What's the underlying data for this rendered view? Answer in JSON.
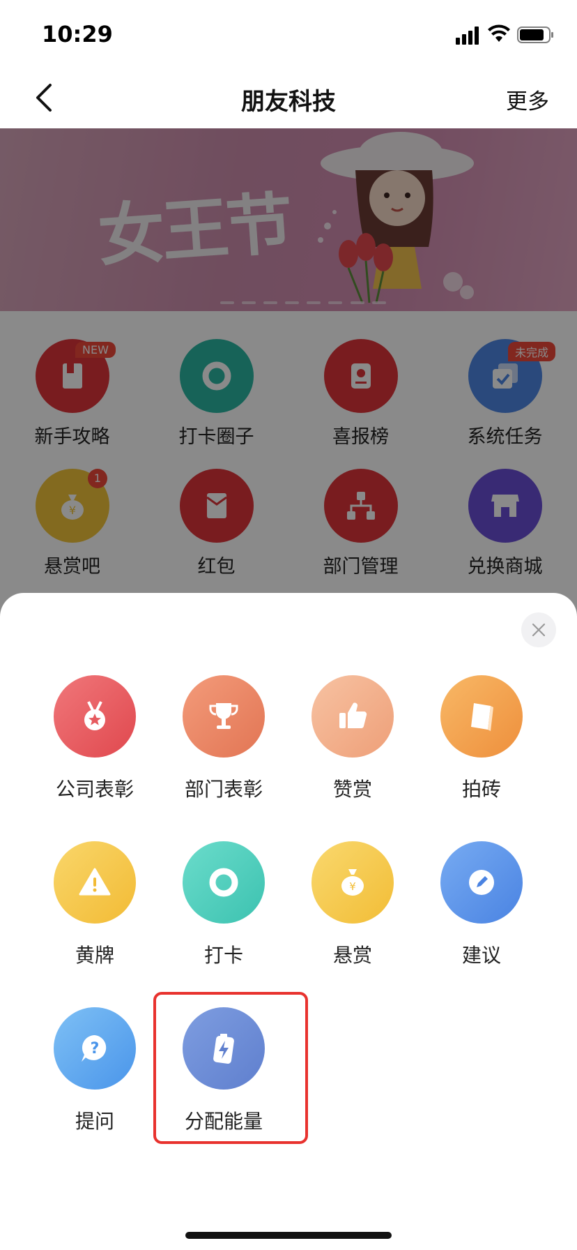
{
  "status_bar": {
    "time": "10:29"
  },
  "nav": {
    "title": "朋友科技",
    "more_label": "更多"
  },
  "banner": {
    "title": "女王节"
  },
  "grid": {
    "items": [
      {
        "label": "新手攻略",
        "badge": "NEW",
        "color": "#e0353a",
        "icon": "book-icon"
      },
      {
        "label": "打卡圈子",
        "color": "#2bb7a3",
        "icon": "ring-icon"
      },
      {
        "label": "喜报榜",
        "color": "#e0353a",
        "icon": "certificate-icon"
      },
      {
        "label": "系统任务",
        "badge": "未完成",
        "color": "#4f88e6",
        "icon": "task-check-icon"
      },
      {
        "label": "悬赏吧",
        "badge": "1",
        "color": "#f2c43a",
        "icon": "money-bag-icon"
      },
      {
        "label": "红包",
        "color": "#e0353a",
        "icon": "red-envelope-icon"
      },
      {
        "label": "部门管理",
        "color": "#e0353a",
        "icon": "org-chart-icon"
      },
      {
        "label": "兑换商城",
        "color": "#6a4fd6",
        "icon": "store-icon"
      }
    ]
  },
  "sheet": {
    "items": [
      {
        "label": "公司表彰",
        "color": "#e65a5f",
        "icon": "medal-icon"
      },
      {
        "label": "部门表彰",
        "color": "#e88463",
        "icon": "trophy-icon"
      },
      {
        "label": "赞赏",
        "color": "#f0ac86",
        "icon": "thumbs-up-icon"
      },
      {
        "label": "拍砖",
        "color": "#f2a24d",
        "icon": "brick-icon"
      },
      {
        "label": "黄牌",
        "color": "#f5c544",
        "icon": "warning-icon"
      },
      {
        "label": "打卡",
        "color": "#4ccfbe",
        "icon": "ring-icon"
      },
      {
        "label": "悬赏",
        "color": "#f5c844",
        "icon": "money-bag-icon"
      },
      {
        "label": "建议",
        "color": "#5a93ea",
        "icon": "pencil-icon"
      },
      {
        "label": "提问",
        "color": "#5ba6f0",
        "icon": "question-icon"
      },
      {
        "label": "分配能量",
        "color": "#6f8fd6",
        "icon": "energy-battery-icon"
      }
    ]
  }
}
